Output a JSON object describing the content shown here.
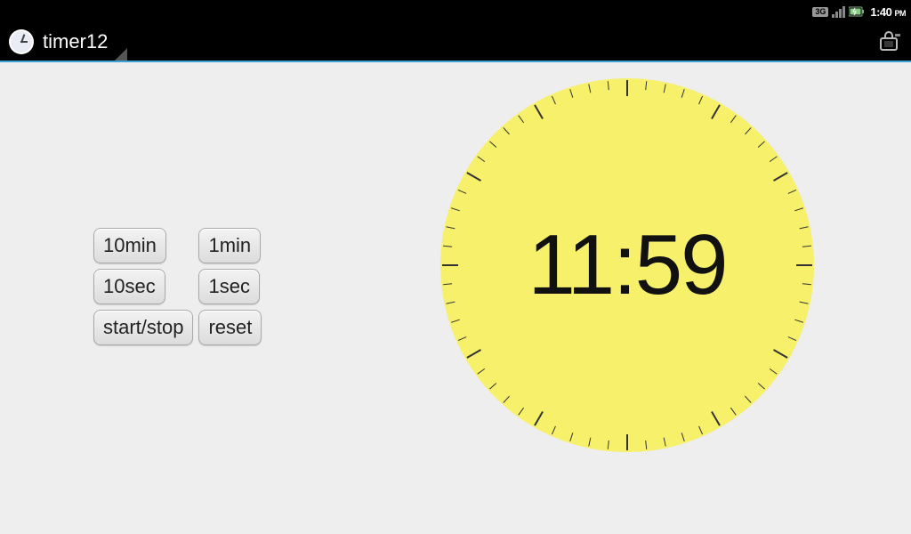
{
  "status": {
    "network_label": "3G",
    "time": "1:40",
    "time_suffix": "PM"
  },
  "header": {
    "title": "timer12"
  },
  "controls": {
    "btn_10min": "10min",
    "btn_1min": "1min",
    "btn_10sec": "10sec",
    "btn_1sec": "1sec",
    "btn_start_stop": "start/stop",
    "btn_reset": "reset"
  },
  "timer": {
    "display": "11:59"
  }
}
